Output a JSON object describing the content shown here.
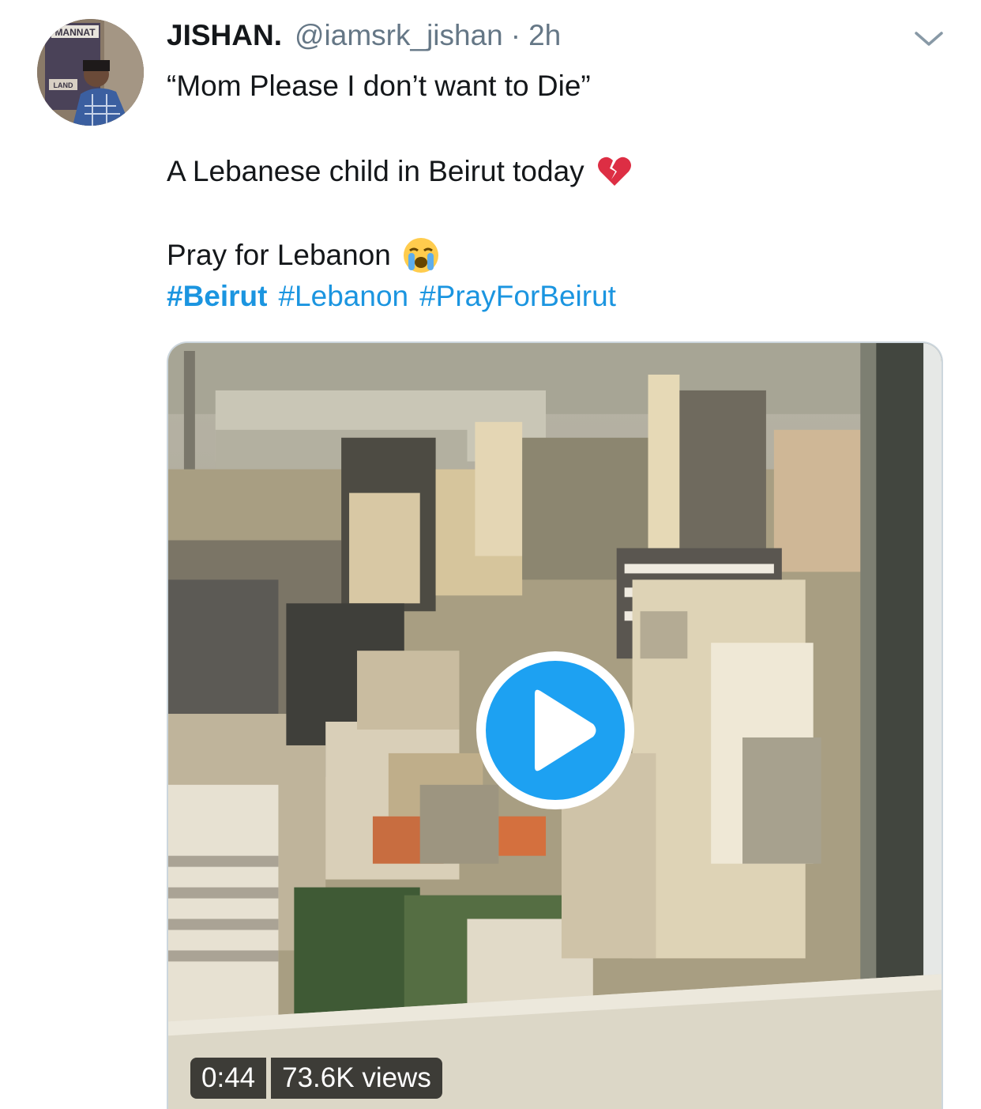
{
  "tweet": {
    "display_name": "JISHAN.",
    "handle": "@iamsrk_jishan",
    "separator": "·",
    "timestamp": "2h",
    "lines": [
      "“Mom Please I don’t want to Die”",
      "A Lebanese child in Beirut today",
      "Pray for Lebanon"
    ],
    "emoji": [
      "broken-heart-emoji",
      "crying-face-emoji"
    ],
    "hashtags": [
      "#Beirut",
      "#Lebanon",
      "#PrayForBeirut"
    ],
    "avatar_text": [
      "MANNAT",
      "LAND"
    ]
  },
  "video": {
    "duration": "0:44",
    "views": "73.6K views"
  },
  "colors": {
    "text": "#14171a",
    "secondary": "#657786",
    "link": "#1b95e0",
    "play": "#1da1f2"
  }
}
